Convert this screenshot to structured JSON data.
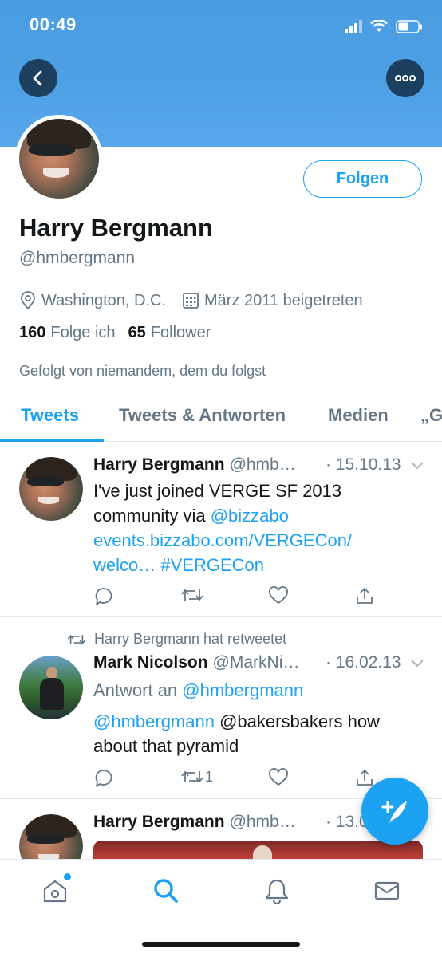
{
  "status_bar": {
    "time": "00:49"
  },
  "profile": {
    "name": "Harry Bergmann",
    "handle": "@hmbergmann",
    "follow_label": "Folgen",
    "location": "Washington, D.C.",
    "joined": "März 2011 beigetreten",
    "following_count": "160",
    "following_label": "Folge ich",
    "followers_count": "65",
    "followers_label": "Follower",
    "followed_by": "Gefolgt von niemandem, dem du folgst"
  },
  "tabs": [
    {
      "label": "Tweets",
      "active": true
    },
    {
      "label": "Tweets & Antworten",
      "active": false
    },
    {
      "label": "Medien",
      "active": false
    },
    {
      "label": "„G",
      "active": false
    }
  ],
  "tweets": [
    {
      "name": "Harry Bergmann",
      "handle": "@hmb…",
      "date": "· 15.10.13",
      "text_line1": "I've just joined VERGE SF 2013",
      "text_line2": "community via ",
      "mention": "@bizzabo",
      "link_line": "events.bizzabo.com/VERGECon/",
      "link_line2": "welco…",
      "hashtag": "#VERGECon"
    },
    {
      "retweet_label": "Harry Bergmann hat retweetet",
      "name": "Mark Nicolson",
      "handle": "@MarkNi…",
      "date": "· 16.02.13",
      "reply_prefix": "Antwort an ",
      "reply_to": "@hmbergmann",
      "mention": "@hmbergmann",
      "text_rest": " @bakersbakers how",
      "text_line2": "about that pyramid",
      "retweet_count": "1"
    },
    {
      "name": "Harry Bergmann",
      "handle": "@hmb…",
      "date": "· 13.0"
    }
  ],
  "icons": {
    "back": "chevron-left-icon",
    "more": "more-dots-icon",
    "location": "location-pin-icon",
    "calendar": "calendar-icon",
    "reply": "reply-icon",
    "retweet": "retweet-icon",
    "like": "heart-icon",
    "share": "share-icon",
    "compose": "compose-tweet-icon",
    "home": "home-icon",
    "search": "search-icon",
    "notifications": "bell-icon",
    "messages": "mail-icon"
  },
  "colors": {
    "accent": "#1da1f2",
    "secondary_text": "#657786",
    "banner": "#4d9fe3"
  }
}
